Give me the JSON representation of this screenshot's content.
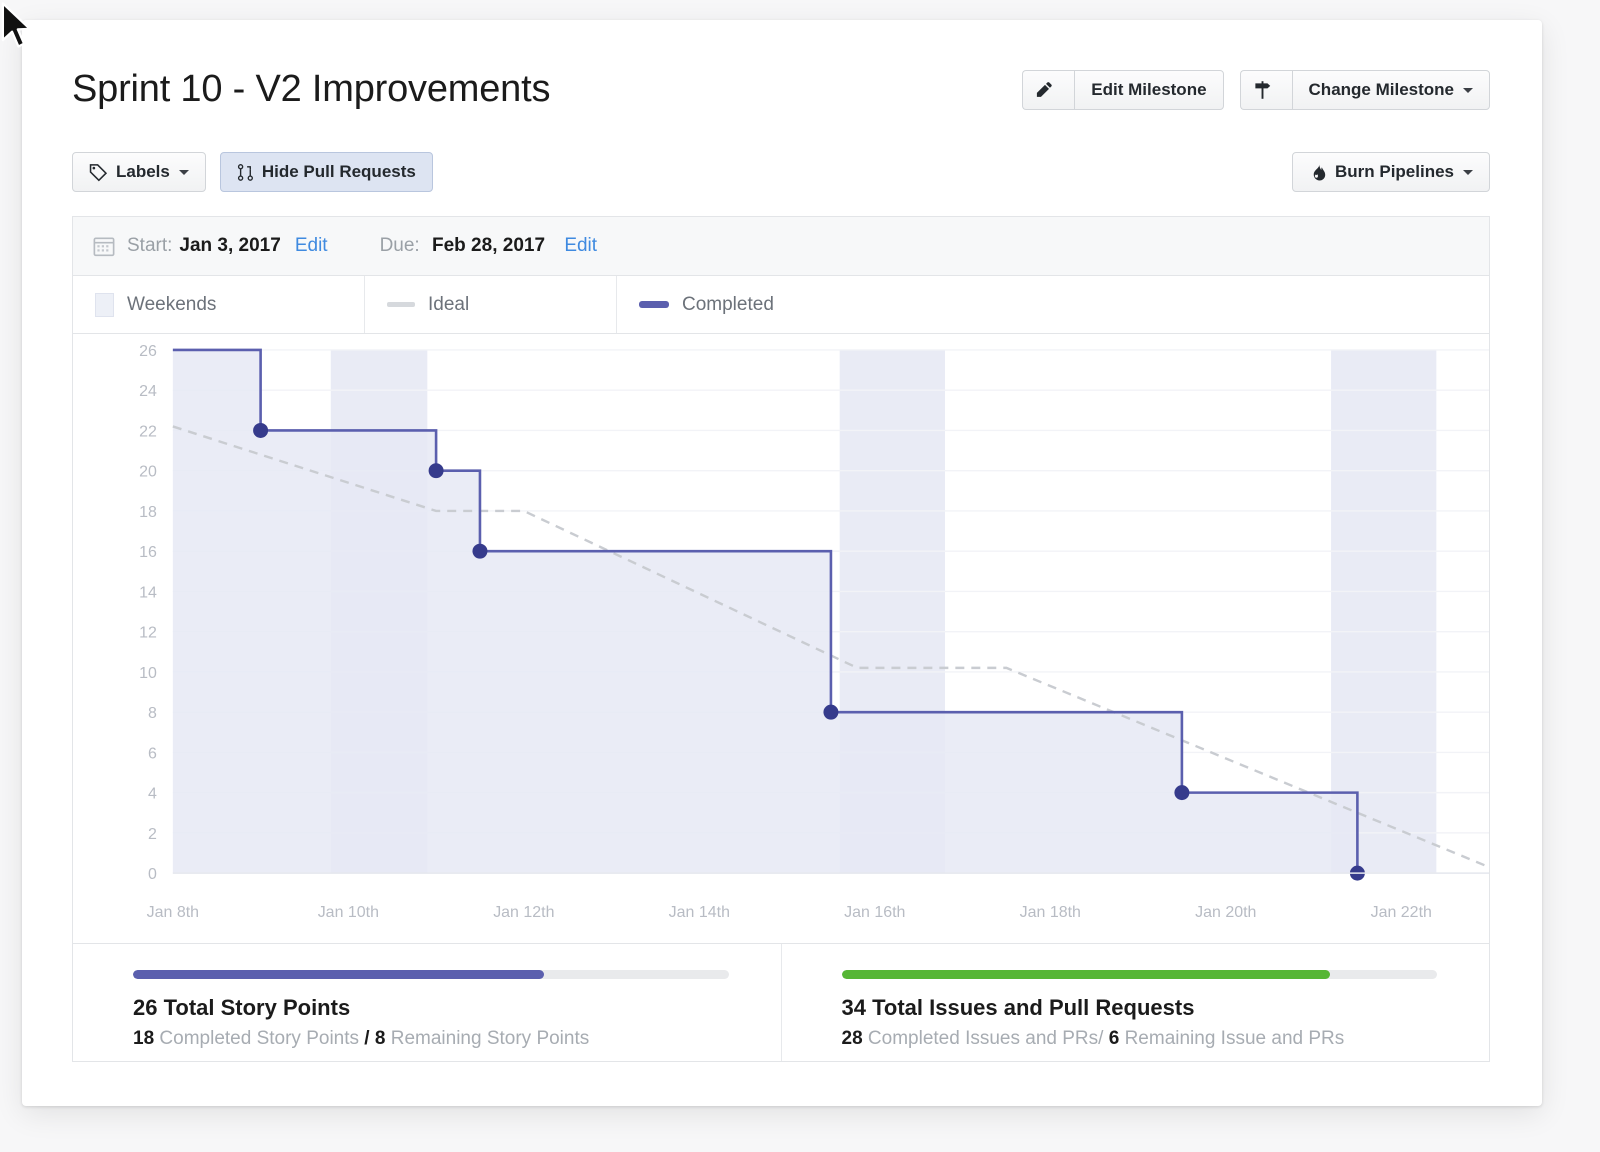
{
  "header": {
    "title": "Sprint 10 - V2 Improvements",
    "edit_milestone_label": "Edit Milestone",
    "change_milestone_label": "Change Milestone",
    "labels_label": "Labels",
    "hide_pull_requests_label": "Hide Pull Requests",
    "burn_pipelines_label": "Burn Pipelines"
  },
  "dates": {
    "start_label": "Start:",
    "start_value": "Jan 3, 2017",
    "start_edit": "Edit",
    "due_label": "Due:",
    "due_value": "Feb 28, 2017",
    "due_edit": "Edit"
  },
  "legend": {
    "weekends": "Weekends",
    "ideal": "Ideal",
    "completed": "Completed"
  },
  "stats": {
    "story_points": {
      "total": "26 Total Story Points",
      "completed_num": "18",
      "completed_text": "Completed Story Points",
      "separator": "/",
      "remaining_num": "8",
      "remaining_text": "Remaining Story Points",
      "percent": 69,
      "color": "#5b5fae"
    },
    "issues": {
      "total": "34 Total Issues and Pull Requests",
      "completed_num": "28",
      "completed_text": "Completed Issues and PRs/",
      "remaining_num": "6",
      "remaining_text": "Remaining Issue and PRs",
      "percent": 82,
      "color": "#56b635"
    }
  },
  "chart_data": {
    "type": "line",
    "title": "",
    "xlabel": "",
    "ylabel": "",
    "ylim": [
      0,
      26
    ],
    "yticks": [
      0,
      2,
      4,
      6,
      8,
      10,
      12,
      14,
      16,
      18,
      20,
      22,
      24,
      26
    ],
    "xticks": [
      "Jan 8th",
      "Jan 10th",
      "Jan 12th",
      "Jan 14th",
      "Jan 16th",
      "Jan 18th",
      "Jan 20th",
      "Jan 22th"
    ],
    "x_domain": [
      "Jan 8",
      "Jan 23"
    ],
    "grid": true,
    "legend_position": "top",
    "colors": {
      "completed_line": "#5b5fae",
      "completed_point": "#363b8c",
      "completed_fill": "#e6e9f4",
      "ideal_line": "#c9ccd1",
      "weekend_band": "#e9ebf5",
      "gridline": "#f2f3f7"
    },
    "series": [
      {
        "name": "Completed",
        "style": "step",
        "points": [
          {
            "x": "Jan 8",
            "y": 26,
            "marker": false
          },
          {
            "x": "Jan 9",
            "y": 22,
            "marker": true
          },
          {
            "x": "Jan 11",
            "y": 20,
            "marker": true
          },
          {
            "x": "Jan 11.5",
            "y": 16,
            "marker": true
          },
          {
            "x": "Jan 15.5",
            "y": 8,
            "marker": true
          },
          {
            "x": "Jan 19.5",
            "y": 4,
            "marker": true
          },
          {
            "x": "Jan 21.5",
            "y": 0,
            "marker": true
          }
        ]
      },
      {
        "name": "Ideal",
        "style": "dashed",
        "points": [
          {
            "x": "Jan 8",
            "y": 22.2
          },
          {
            "x": "Jan 11",
            "y": 18.0
          },
          {
            "x": "Jan 12",
            "y": 18.0
          },
          {
            "x": "Jan 15.8",
            "y": 10.2
          },
          {
            "x": "Jan 17.5",
            "y": 10.2
          },
          {
            "x": "Jan 23",
            "y": 0.3
          }
        ]
      }
    ],
    "weekend_bands": [
      {
        "start": "Jan 9.8",
        "end": "Jan 10.9"
      },
      {
        "start": "Jan 15.6",
        "end": "Jan 16.8"
      },
      {
        "start": "Jan 21.2",
        "end": "Jan 22.4"
      }
    ]
  }
}
